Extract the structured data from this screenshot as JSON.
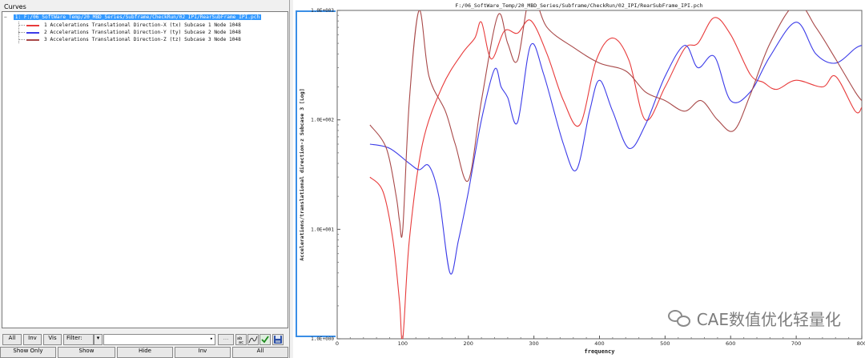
{
  "left_panel": {
    "header": "Curves",
    "tree_root": {
      "toggle": "−",
      "label": "1: F:/06_SoftWare_Temp/20_MBD_Series/Subframe/CheckRun/02_IPI/RearSubFrame_IPI.pch"
    },
    "curves": [
      {
        "label": "1 Accelerations Translational Direction-X (tx) Subcase 1 Node 1048",
        "color": "#e83b3b"
      },
      {
        "label": "2 Accelerations Translational Direction-Y (ty) Subcase 2 Node 1048",
        "color": "#3b3be8"
      },
      {
        "label": "3 Accelerations Translational Direction-Z (tz) Subcase 3 Node 1048",
        "color": "#a84848"
      }
    ],
    "toolbar": {
      "all": "All",
      "inv": "Inv",
      "vis": "Vis",
      "filter": "Filter:",
      "dots": "...",
      "abc_icon": "abc-icon",
      "curve_icon": "curve-icon",
      "check_icon": "check-icon",
      "save_icon": "save-icon"
    },
    "bottom_buttons": {
      "show_only": "Show Only",
      "show": "Show",
      "hide": "Hide",
      "inv": "Inv",
      "all": "All"
    }
  },
  "plot": {
    "title": "F:/06_SoftWare_Temp/20_MBD_Series/Subframe/CheckRun/02_IPI/RearSubFrame_IPI.pch",
    "watermark": "CAE数值优化轻量化"
  },
  "chart_data": {
    "type": "line",
    "xlabel": "frequency",
    "ylabel": "Accelerations/translational direction-z  Subcase 3 [Log]",
    "xlim": [
      0,
      800
    ],
    "ylim_log10": [
      0,
      3
    ],
    "log_y": true,
    "x_ticks": [
      "0",
      "100",
      "200",
      "300",
      "400",
      "500",
      "600",
      "700",
      "800"
    ],
    "y_ticks": [
      "1.0E+000",
      "1.0E+001",
      "1.0E+002",
      "1.0E+003"
    ],
    "grid": false,
    "series": [
      {
        "name": "1 Accelerations Translational Direction-X (tx) Subcase 1 Node 1048",
        "color": "#e83b3b",
        "x": [
          50,
          70,
          85,
          95,
          100,
          110,
          130,
          160,
          190,
          210,
          220,
          235,
          255,
          275,
          295,
          320,
          345,
          370,
          395,
          420,
          445,
          470,
          500,
          530,
          550,
          575,
          600,
          630,
          650,
          670,
          700,
          740,
          760,
          790,
          800
        ],
        "y": [
          30,
          22,
          8,
          2.2,
          1,
          8,
          60,
          200,
          400,
          560,
          780,
          360,
          650,
          620,
          810,
          400,
          150,
          90,
          350,
          560,
          350,
          100,
          200,
          450,
          500,
          860,
          600,
          260,
          220,
          190,
          230,
          200,
          250,
          120,
          130
        ]
      },
      {
        "name": "2 Accelerations Translational Direction-Y (ty) Subcase 2 Node 1048",
        "color": "#3b3be8",
        "x": [
          50,
          80,
          110,
          125,
          140,
          155,
          172,
          185,
          200,
          220,
          240,
          250,
          260,
          275,
          295,
          315,
          345,
          365,
          385,
          400,
          420,
          445,
          470,
          500,
          530,
          550,
          575,
          600,
          630,
          660,
          700,
          730,
          760,
          790,
          800
        ],
        "y": [
          60,
          55,
          40,
          35,
          38,
          20,
          4,
          8,
          22,
          100,
          290,
          200,
          160,
          95,
          480,
          260,
          60,
          35,
          120,
          230,
          120,
          55,
          90,
          250,
          480,
          300,
          380,
          150,
          180,
          380,
          780,
          400,
          330,
          450,
          480
        ]
      },
      {
        "name": "3 Accelerations Translational Direction-Z (tz) Subcase 3 Node 1048",
        "color": "#a84848",
        "x": [
          50,
          75,
          90,
          95,
          100,
          110,
          125,
          140,
          165,
          180,
          200,
          220,
          245,
          260,
          275,
          295,
          320,
          360,
          400,
          440,
          470,
          500,
          530,
          555,
          580,
          605,
          630,
          660,
          700,
          730,
          760,
          790,
          800
        ],
        "y": [
          90,
          55,
          20,
          12,
          10,
          150,
          1000,
          250,
          120,
          60,
          28,
          150,
          900,
          500,
          350,
          1400,
          700,
          460,
          330,
          280,
          180,
          150,
          120,
          150,
          100,
          80,
          170,
          500,
          1150,
          700,
          360,
          180,
          150
        ]
      }
    ]
  }
}
